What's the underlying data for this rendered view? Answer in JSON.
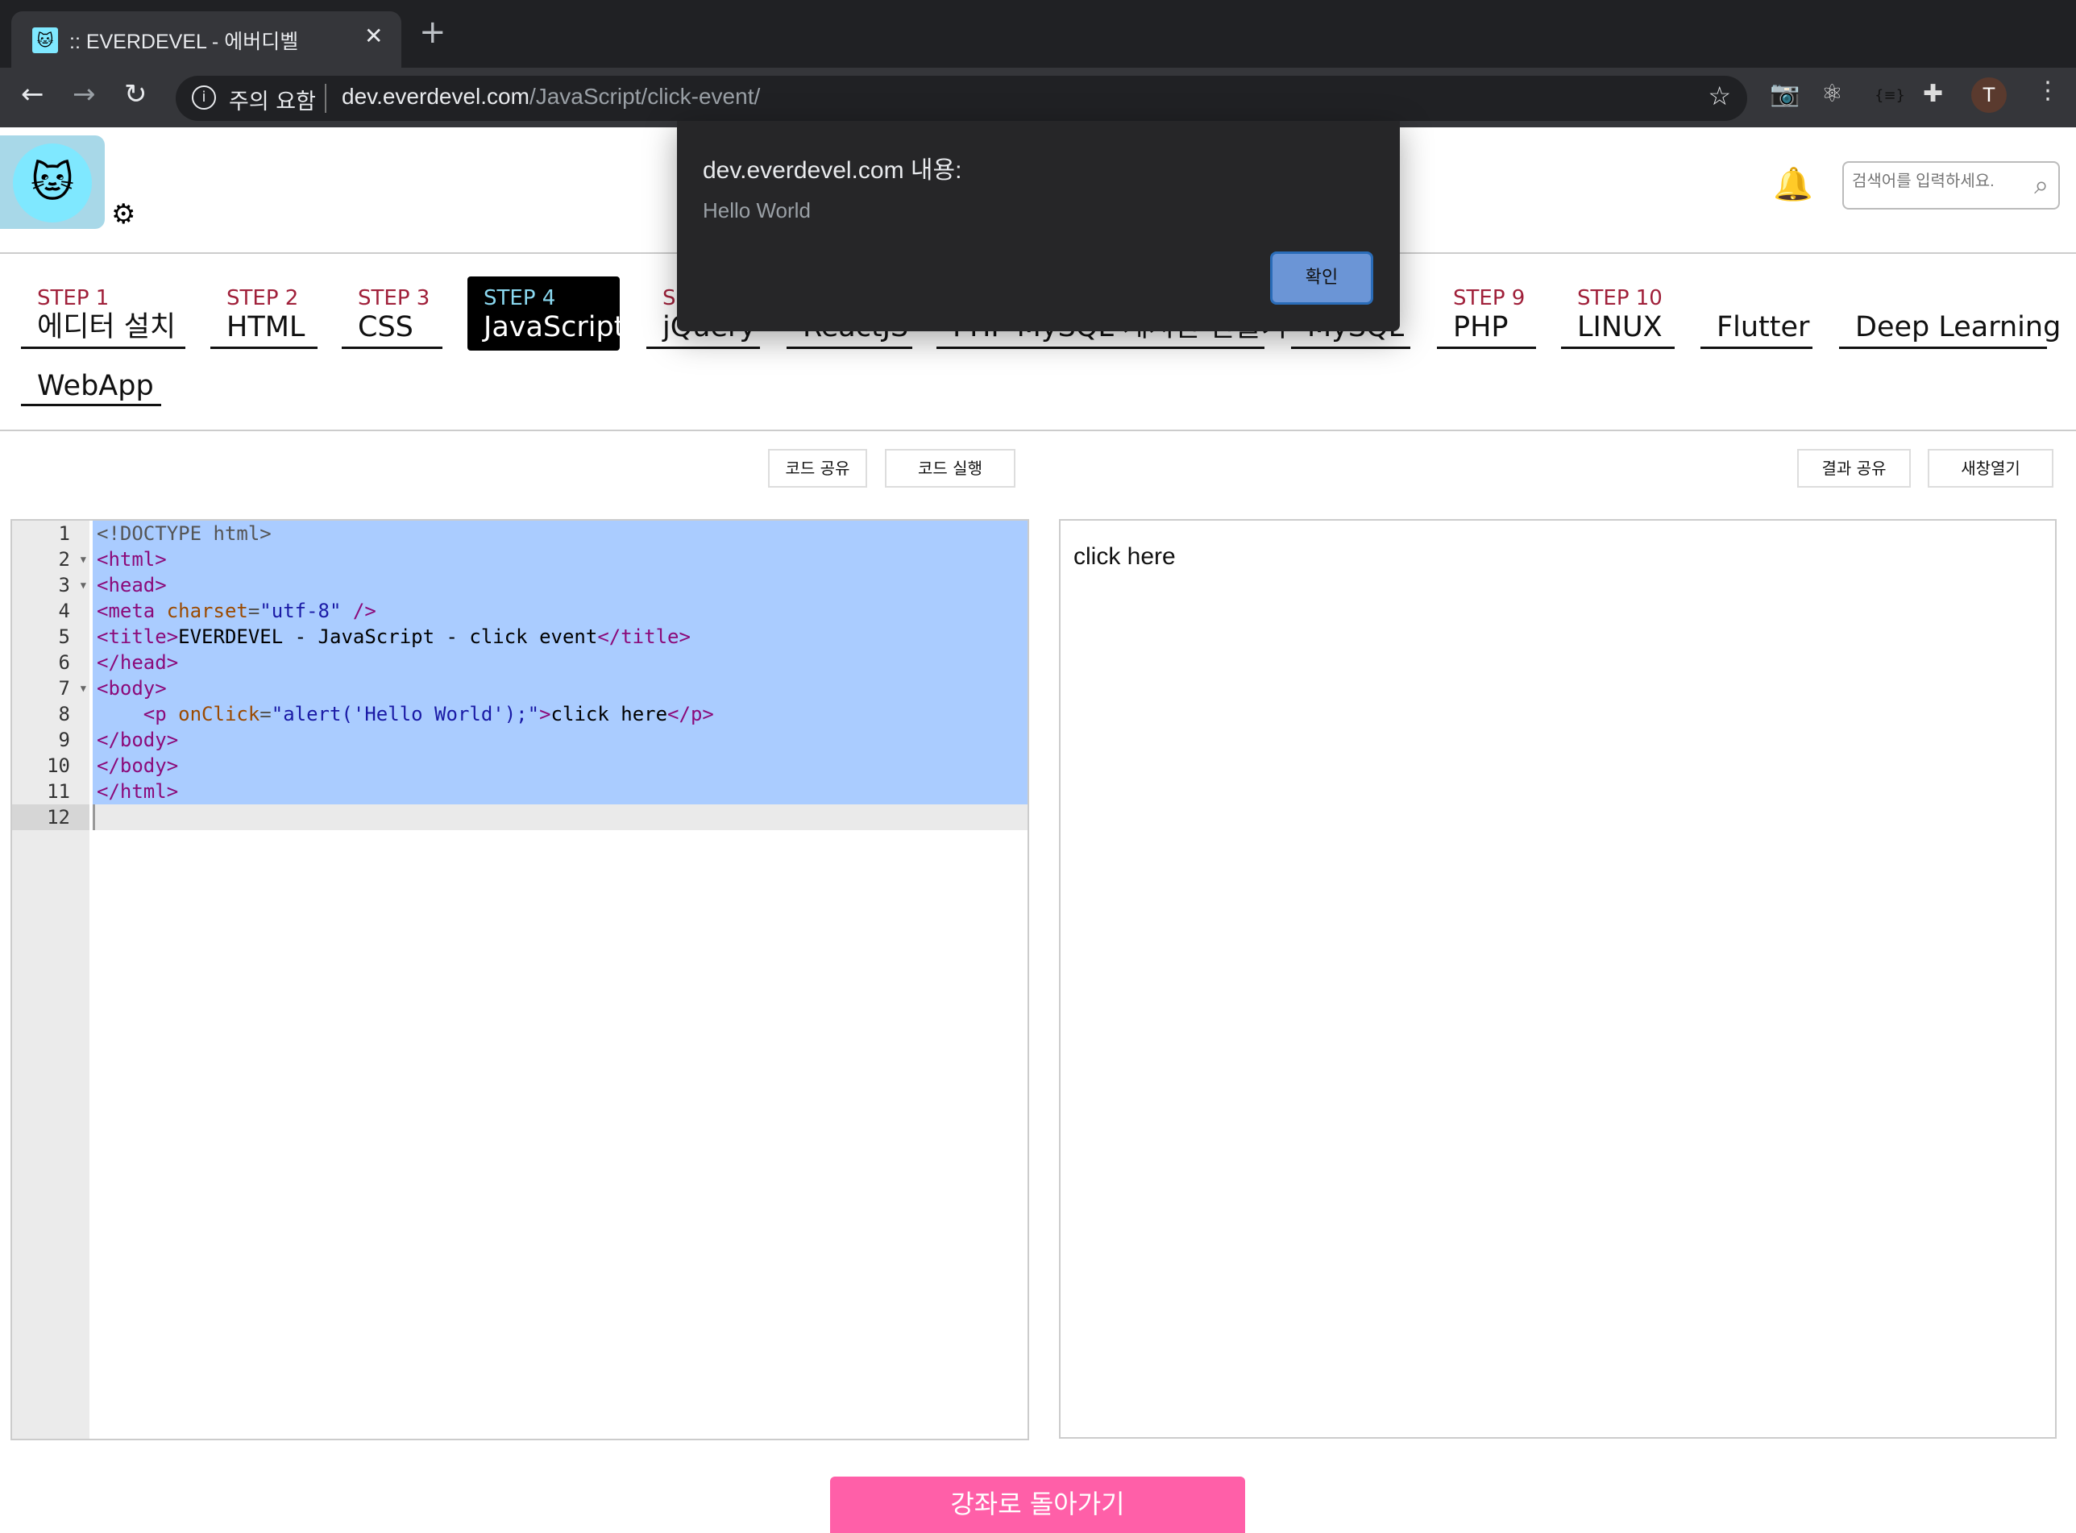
{
  "browser": {
    "tab_title": ":: EVERDEVEL - 에버디벨",
    "security_label": "주의 요함",
    "url_host": "dev.everdevel.com",
    "url_path": "/JavaScript/click-event/",
    "profile_initial": "T"
  },
  "header": {
    "search_placeholder": "검색어를 입력하세요."
  },
  "nav": {
    "tabs": [
      {
        "step": "STEP 1",
        "name": "에디터 설치"
      },
      {
        "step": "STEP 2",
        "name": "HTML"
      },
      {
        "step": "STEP 3",
        "name": "CSS"
      },
      {
        "step": "STEP 4",
        "name": "JavaScript",
        "active": true
      },
      {
        "step": "S",
        "name": "jQuery"
      },
      {
        "step": "",
        "name": "ReactJS"
      },
      {
        "step": "",
        "name": "PHP MySQL 게시판 만들기"
      },
      {
        "step": "",
        "name": "MySQL"
      },
      {
        "step": "STEP 9",
        "name": "PHP"
      },
      {
        "step": "STEP 10",
        "name": "LINUX"
      },
      {
        "step": "",
        "name": "Flutter"
      },
      {
        "step": "",
        "name": "Deep Learning"
      },
      {
        "step": "",
        "name": "WebApp"
      }
    ]
  },
  "toolbar": {
    "share_code": "코드 공유",
    "run_code": "코드 실행",
    "share_result": "결과 공유",
    "new_window": "새창열기"
  },
  "editor": {
    "line_numbers": [
      "1",
      "2",
      "3",
      "4",
      "5",
      "6",
      "7",
      "8",
      "9",
      "10",
      "11",
      "12"
    ],
    "lines": [
      "<!DOCTYPE html>",
      "<html>",
      "<head>",
      "<meta charset=\"utf-8\" />",
      "<title>EVERDEVEL - JavaScript - click event</title>",
      "</head>",
      "<body>",
      "    <p onClick=\"alert('Hello World');\">click here</p>",
      "</body>",
      "</body>",
      "</html>",
      ""
    ]
  },
  "result": {
    "text": "click here"
  },
  "back_button": "강좌로 돌아가기",
  "alert": {
    "title": "dev.everdevel.com 내용:",
    "message": "Hello World",
    "ok_label": "확인"
  },
  "colors": {
    "accent_pink": "#ff5fa8",
    "selection": "#aaccff",
    "dialog_button": "#6b95d6"
  }
}
